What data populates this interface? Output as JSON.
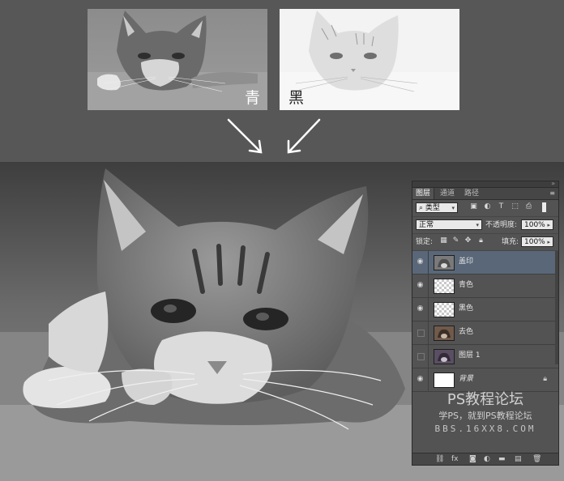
{
  "thumbnails": [
    {
      "label": "青"
    },
    {
      "label": "黑"
    }
  ],
  "layers_panel": {
    "tabs": [
      "图层",
      "通道",
      "路径"
    ],
    "filter": {
      "kind_label": "类型"
    },
    "blend_mode": "正常",
    "opacity": {
      "label": "不透明度:",
      "value": "100%"
    },
    "lock": {
      "label": "锁定:"
    },
    "fill": {
      "label": "填充:",
      "value": "100%"
    },
    "layers": [
      {
        "name": "盖印",
        "visible": true,
        "selected": true
      },
      {
        "name": "青色",
        "visible": true,
        "selected": false
      },
      {
        "name": "黑色",
        "visible": true,
        "selected": false
      },
      {
        "name": "去色",
        "visible": false,
        "selected": false
      },
      {
        "name": "图层 1",
        "visible": false,
        "selected": false
      },
      {
        "name": "背景",
        "visible": true,
        "selected": false,
        "locked": true
      }
    ],
    "selection_color": "#596779"
  },
  "watermark": {
    "line1": "PS教程论坛",
    "line2": "学PS，就到PS教程论坛",
    "line3": "BBS.16XX8.COM"
  }
}
